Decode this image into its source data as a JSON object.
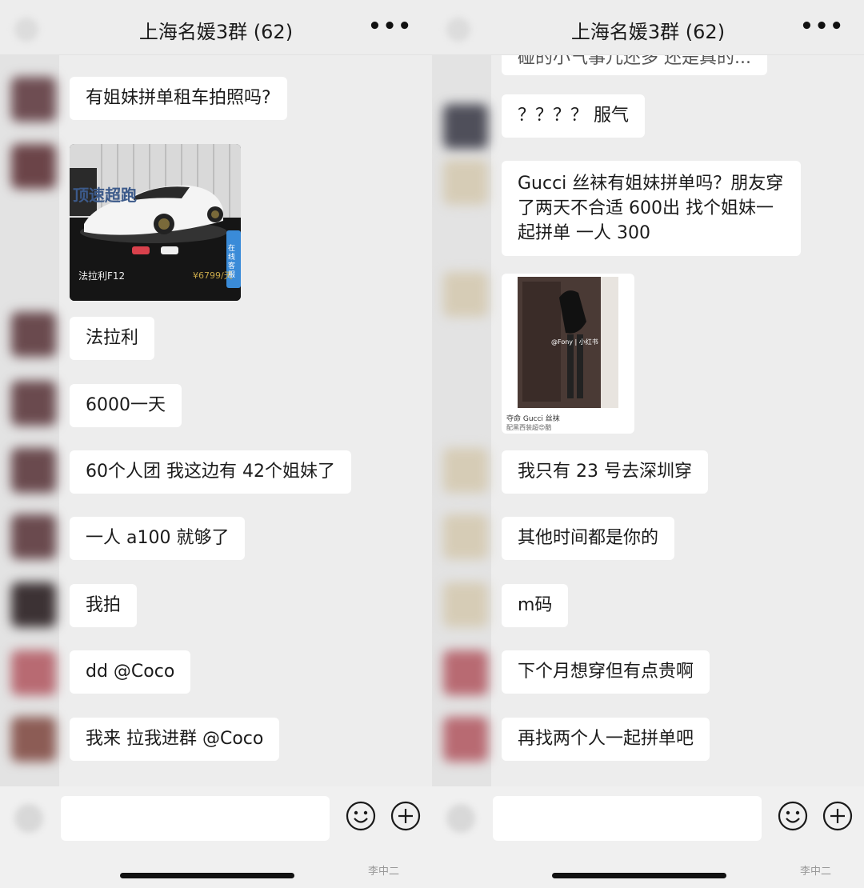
{
  "group_title": "上海名媛3群 (62)",
  "more_icon": "more-horizontal-icon",
  "left": {
    "messages": [
      {
        "text": "有姐妹拼单租车拍照吗?"
      },
      {
        "image": {
          "caption": "法拉利F12",
          "price": "¥6799/天",
          "badge": "在线客服",
          "brand": "顶速超跑"
        }
      },
      {
        "text": "法拉利"
      },
      {
        "text": "6000一天"
      },
      {
        "text": "60个人团 我这边有 42个姐妹了"
      },
      {
        "text": "一人 a100 就够了"
      },
      {
        "text": "我拍"
      },
      {
        "text": "dd @Coco"
      },
      {
        "text": "我来 拉我进群 @Coco"
      }
    ]
  },
  "right": {
    "messages": [
      {
        "text": "碰的小气事儿还多 还是真的..."
      },
      {
        "text": "？？？？ 服气"
      },
      {
        "text": "Gucci 丝袜有姐妹拼单吗？朋友穿了两天不合适 600出 找个姐妹一起拼单 一人 300"
      },
      {
        "image": {
          "caption": "夺命 Gucci 丝袜",
          "subcaption": "配黑西装超😍酷",
          "tag": "@Fony | 小红书"
        }
      },
      {
        "text": "我只有 23 号去深圳穿"
      },
      {
        "text": "其他时间都是你的"
      },
      {
        "text": "m码"
      },
      {
        "text": "下个月想穿但有点贵啊"
      },
      {
        "text": "再找两个人一起拼单吧"
      }
    ]
  },
  "input_bar": {
    "emoji_icon": "emoji-icon",
    "plus_icon": "plus-icon"
  },
  "watermark": "李中二"
}
